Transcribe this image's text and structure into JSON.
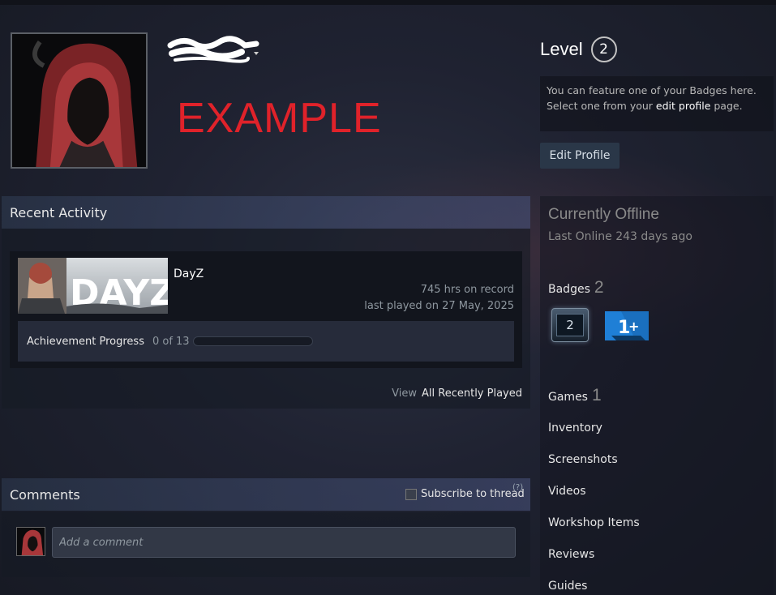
{
  "profile": {
    "example_text": "EXAMPLE",
    "level_label": "Level",
    "level_value": "2",
    "badge_feature_line1": "You can feature one of your Badges here.",
    "badge_feature_line2_pre": "Select one from your ",
    "badge_feature_link": "edit profile",
    "badge_feature_line2_post": " page.",
    "edit_profile_label": "Edit Profile"
  },
  "sidebar": {
    "status": "Currently Offline",
    "last_online": "Last Online 243 days ago",
    "badges_label": "Badges",
    "badges_count": "2",
    "badge_icon1_text": "2",
    "games_label": "Games",
    "games_count": "1",
    "links": [
      "Inventory",
      "Screenshots",
      "Videos",
      "Workshop Items",
      "Reviews",
      "Guides"
    ]
  },
  "recent_activity": {
    "title": "Recent Activity",
    "game": {
      "name": "DayZ",
      "image_text": "DAYZ",
      "hours": "745 hrs on record",
      "last_played": "last played on 27 May, 2025",
      "achievement_label": "Achievement Progress",
      "achievement_count": "0 of 13",
      "achievement_progress": 0
    },
    "view_label": "View",
    "view_link": "All Recently Played"
  },
  "comments": {
    "title": "Comments",
    "subscribe_label": "Subscribe to thread",
    "help_mark": "(?)",
    "placeholder": "Add a comment"
  },
  "colors": {
    "example_red": "#e0222a",
    "background": "#1f2231",
    "accent_blue": "#1a9fff"
  }
}
